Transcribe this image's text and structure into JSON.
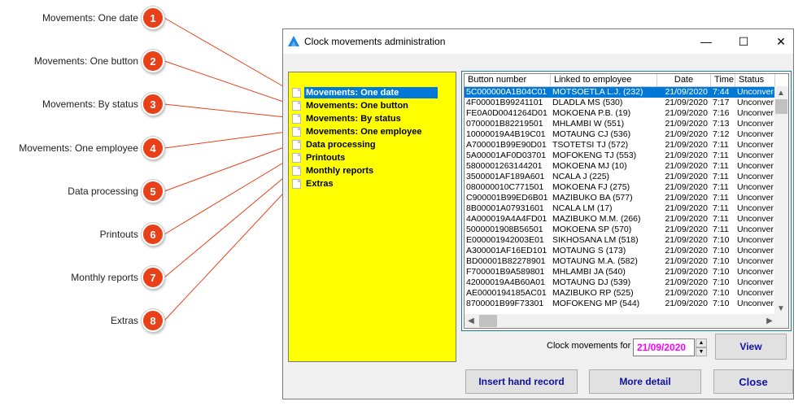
{
  "callouts": [
    {
      "number": "1",
      "label": "Movements: One date"
    },
    {
      "number": "2",
      "label": "Movements: One button"
    },
    {
      "number": "3",
      "label": "Movements: By status"
    },
    {
      "number": "4",
      "label": "Movements: One employee"
    },
    {
      "number": "5",
      "label": "Data processing"
    },
    {
      "number": "6",
      "label": "Printouts"
    },
    {
      "number": "7",
      "label": "Monthly reports"
    },
    {
      "number": "8",
      "label": "Extras"
    }
  ],
  "window": {
    "title": "Clock movements administration",
    "controls": {
      "minimize": "—",
      "maximize": "☐",
      "close": "✕"
    }
  },
  "menu": {
    "items": [
      {
        "label": "Movements: One date",
        "selected": true
      },
      {
        "label": "Movements: One button"
      },
      {
        "label": "Movements: By status"
      },
      {
        "label": "Movements: One employee"
      },
      {
        "label": "Data processing"
      },
      {
        "label": "Printouts"
      },
      {
        "label": "Monthly reports"
      },
      {
        "label": "Extras"
      }
    ]
  },
  "list": {
    "columns": [
      "Button number",
      "Linked to employee",
      "Date",
      "Time",
      "Status"
    ],
    "rows": [
      [
        "5C000000A1B04C01",
        "MOTSOETLA L.J. (232)",
        "21/09/2020",
        "7:44",
        "Unconver"
      ],
      [
        "4F00001B99241101",
        "DLADLA MS (530)",
        "21/09/2020",
        "7:17",
        "Unconver"
      ],
      [
        "FE0A0D0041264D01",
        "MOKOENA P.B. (19)",
        "21/09/2020",
        "7:16",
        "Unconver"
      ],
      [
        "0700001B82219501",
        "MHLAMBI W (551)",
        "21/09/2020",
        "7:13",
        "Unconver"
      ],
      [
        "10000019A4B19C01",
        "MOTAUNG CJ (536)",
        "21/09/2020",
        "7:12",
        "Unconver"
      ],
      [
        "A700001B99E90D01",
        "TSOTETSI TJ (572)",
        "21/09/2020",
        "7:11",
        "Unconver"
      ],
      [
        "5A00001AF0D03701",
        "MOFOKENG TJ (553)",
        "21/09/2020",
        "7:11",
        "Unconver"
      ],
      [
        "5800001263144201",
        "MOKOENA MJ (10)",
        "21/09/2020",
        "7:11",
        "Unconver"
      ],
      [
        "3500001AF189A601",
        "NCALA J (225)",
        "21/09/2020",
        "7:11",
        "Unconver"
      ],
      [
        "080000010C771501",
        "MOKOENA FJ (275)",
        "21/09/2020",
        "7:11",
        "Unconver"
      ],
      [
        "C900001B99ED6B01",
        "MAZIBUKO BA (577)",
        "21/09/2020",
        "7:11",
        "Unconver"
      ],
      [
        "8B00001A07931601",
        "NCALA LM (17)",
        "21/09/2020",
        "7:11",
        "Unconver"
      ],
      [
        "4A000019A4A4FD01",
        "MAZIBUKO M.M. (266)",
        "21/09/2020",
        "7:11",
        "Unconver"
      ],
      [
        "5000001908B56501",
        "MOKOENA SP (570)",
        "21/09/2020",
        "7:11",
        "Unconver"
      ],
      [
        "E000001942003E01",
        "SIKHOSANA LM (518)",
        "21/09/2020",
        "7:10",
        "Unconver"
      ],
      [
        "A300001AF16ED101",
        "MOTAUNG S (173)",
        "21/09/2020",
        "7:10",
        "Unconver"
      ],
      [
        "BD00001B82278901",
        "MOTAUNG M.A. (582)",
        "21/09/2020",
        "7:10",
        "Unconver"
      ],
      [
        "F700001B9A589801",
        "MHLAMBI JA (540)",
        "21/09/2020",
        "7:10",
        "Unconver"
      ],
      [
        "42000019A4B60A01",
        "MOTAUNG DJ (539)",
        "21/09/2020",
        "7:10",
        "Unconver"
      ],
      [
        "AE0000194185AC01",
        "MAZIBUKO RP (525)",
        "21/09/2020",
        "7:10",
        "Unconver"
      ],
      [
        "8700001B99F73301",
        "MOFOKENG MP (544)",
        "21/09/2020",
        "7:10",
        "Unconver"
      ]
    ]
  },
  "footer": {
    "clock_label": "Clock movements for",
    "date_value": "21/09/2020",
    "view_label": "View",
    "insert_label": "Insert hand record",
    "more_label": "More detail",
    "close_label": "Close"
  },
  "colors": {
    "menu_bg": "#ffff00",
    "selection": "#0078d7",
    "badge": "#e8411a",
    "date_text": "#ff00ff",
    "button_text": "#1010a0"
  }
}
